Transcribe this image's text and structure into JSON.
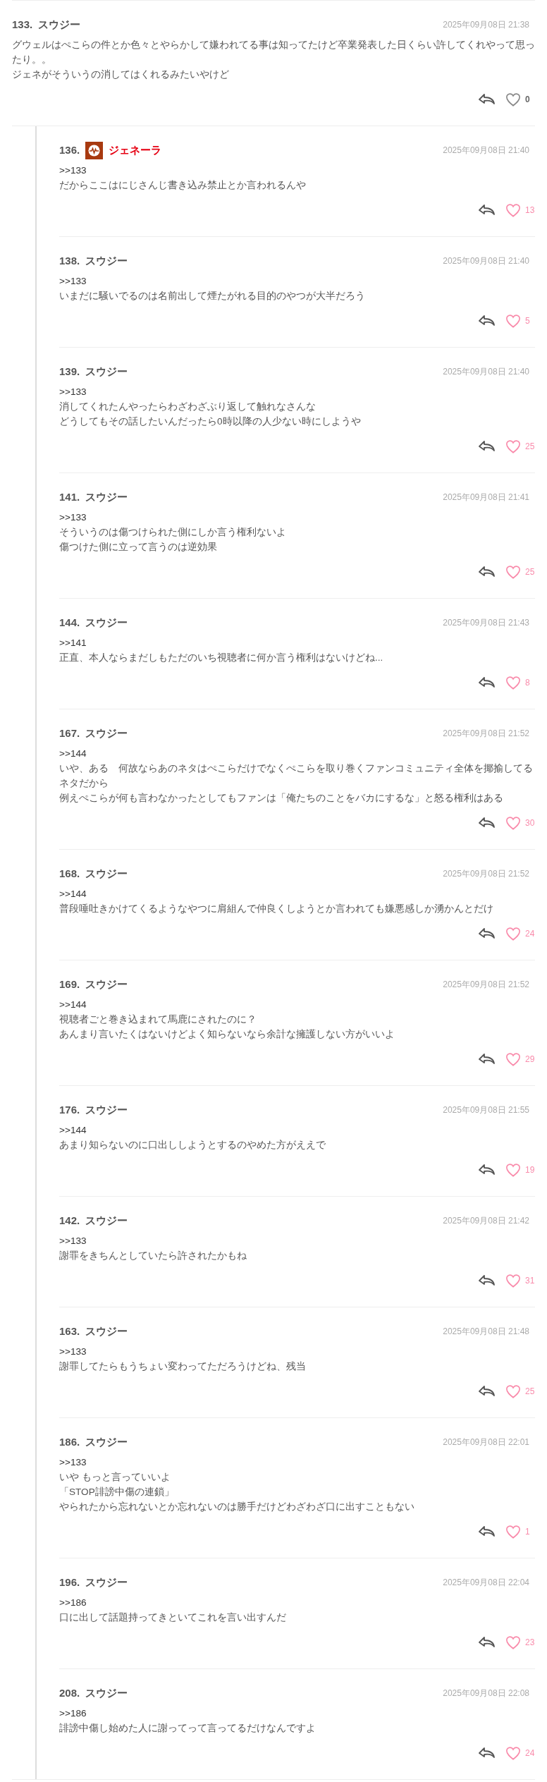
{
  "parent": {
    "number": "133.",
    "name": "スウジー",
    "time": "2025年09月08日 21:38",
    "lines": [
      "グウェルはぺこらの件とか色々とやらかして嫌われてる事は知ってたけど卒業発表した日くらい許してくれやって思ったり。。",
      "ジェネがそういうの消してはくれるみたいやけど"
    ],
    "likes": "0",
    "liked": false
  },
  "replies": [
    {
      "number": "136.",
      "name": "ジェネーラ",
      "kind": "staff",
      "time": "2025年09月08日 21:40",
      "quote": ">>133",
      "lines": [
        "だからここはにじさんじ書き込み禁止とか言われるんや"
      ],
      "likes": "13",
      "liked": true
    },
    {
      "number": "138.",
      "name": "スウジー",
      "kind": "user",
      "time": "2025年09月08日 21:40",
      "quote": ">>133",
      "lines": [
        "いまだに騒いでるのは名前出して煙たがれる目的のやつが大半だろう"
      ],
      "likes": "5",
      "liked": true
    },
    {
      "number": "139.",
      "name": "スウジー",
      "kind": "user",
      "time": "2025年09月08日 21:40",
      "quote": ">>133",
      "lines": [
        "消してくれたんやったらわざわざぶり返して触れなさんな",
        "どうしてもその話したいんだったら0時以降の人少ない時にしようや"
      ],
      "likes": "25",
      "liked": true
    },
    {
      "number": "141.",
      "name": "スウジー",
      "kind": "user",
      "time": "2025年09月08日 21:41",
      "quote": ">>133",
      "lines": [
        "そういうのは傷つけられた側にしか言う権利ないよ",
        "傷つけた側に立って言うのは逆効果"
      ],
      "likes": "25",
      "liked": true
    },
    {
      "number": "144.",
      "name": "スウジー",
      "kind": "user",
      "time": "2025年09月08日 21:43",
      "quote": ">>141",
      "lines": [
        "正直、本人ならまだしもただのいち視聴者に何か言う権利はないけどね..."
      ],
      "likes": "8",
      "liked": true
    },
    {
      "number": "167.",
      "name": "スウジー",
      "kind": "user",
      "time": "2025年09月08日 21:52",
      "quote": ">>144",
      "lines": [
        "いや、ある　何故ならあのネタはぺこらだけでなくぺこらを取り巻くファンコミュニティ全体を揶揄してるネタだから",
        "例えぺこらが何も言わなかったとしてもファンは「俺たちのことをバカにするな」と怒る権利はある"
      ],
      "likes": "30",
      "liked": true
    },
    {
      "number": "168.",
      "name": "スウジー",
      "kind": "user",
      "time": "2025年09月08日 21:52",
      "quote": ">>144",
      "lines": [
        "普段唾吐きかけてくるようなやつに肩組んで仲良くしようとか言われても嫌悪感しか湧かんとだけ"
      ],
      "likes": "24",
      "liked": true
    },
    {
      "number": "169.",
      "name": "スウジー",
      "kind": "user",
      "time": "2025年09月08日 21:52",
      "quote": ">>144",
      "lines": [
        "視聴者ごと巻き込まれて馬鹿にされたのに？",
        "あんまり言いたくはないけどよく知らないなら余計な擁護しない方がいいよ"
      ],
      "likes": "29",
      "liked": true
    },
    {
      "number": "176.",
      "name": "スウジー",
      "kind": "user",
      "time": "2025年09月08日 21:55",
      "quote": ">>144",
      "lines": [
        "あまり知らないのに口出ししようとするのやめた方がええで"
      ],
      "likes": "19",
      "liked": true
    },
    {
      "number": "142.",
      "name": "スウジー",
      "kind": "user",
      "time": "2025年09月08日 21:42",
      "quote": ">>133",
      "lines": [
        "謝罪をきちんとしていたら許されたかもね"
      ],
      "likes": "31",
      "liked": true
    },
    {
      "number": "163.",
      "name": "スウジー",
      "kind": "user",
      "time": "2025年09月08日 21:48",
      "quote": ">>133",
      "lines": [
        "謝罪してたらもうちょい変わってただろうけどね、残当"
      ],
      "likes": "25",
      "liked": true
    },
    {
      "number": "186.",
      "name": "スウジー",
      "kind": "user",
      "time": "2025年09月08日 22:01",
      "quote": ">>133",
      "lines": [
        "いや もっと言っていいよ",
        "「STOP誹謗中傷の連鎖」",
        "やられたから忘れないとか忘れないのは勝手だけどわざわざ口に出すこともない"
      ],
      "likes": "1",
      "liked": true
    },
    {
      "number": "196.",
      "name": "スウジー",
      "kind": "user",
      "time": "2025年09月08日 22:04",
      "quote": ">>186",
      "lines": [
        "口に出して話題持ってきといてこれを言い出すんだ"
      ],
      "likes": "23",
      "liked": true
    },
    {
      "number": "208.",
      "name": "スウジー",
      "kind": "user",
      "time": "2025年09月08日 22:08",
      "quote": ">>186",
      "lines": [
        "誹謗中傷し始めた人に謝ってって言ってるだけなんですよ"
      ],
      "likes": "24",
      "liked": true
    }
  ]
}
